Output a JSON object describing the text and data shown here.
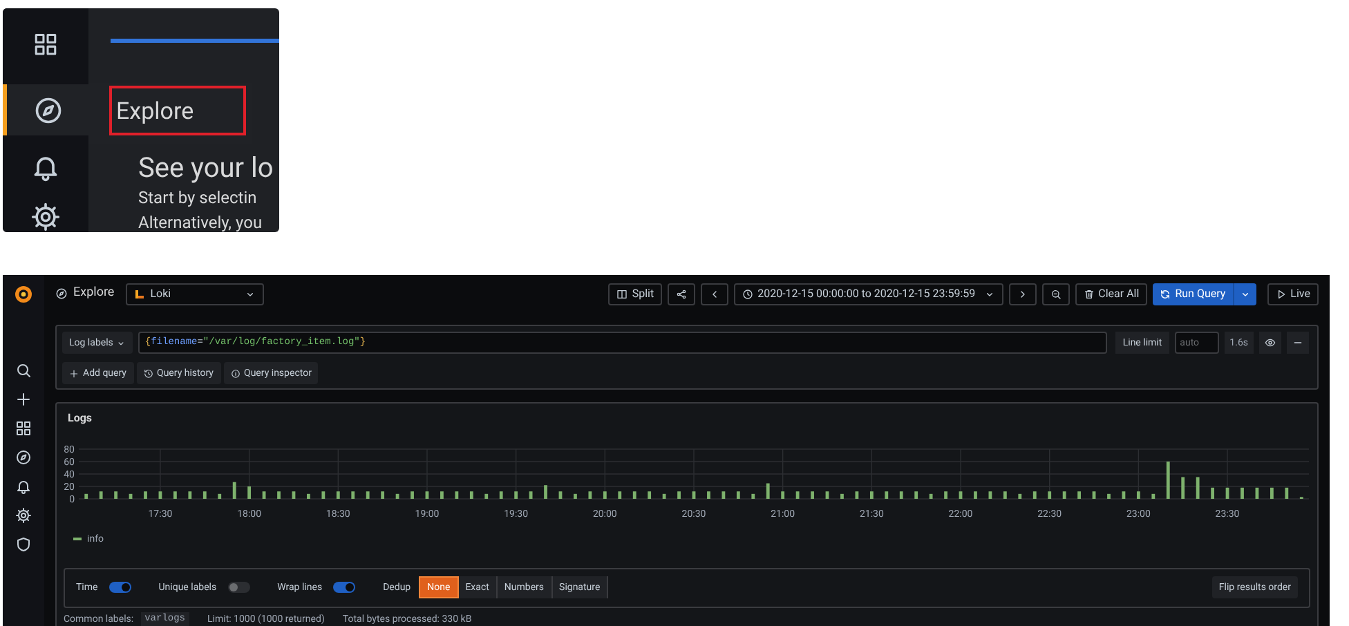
{
  "inset": {
    "tooltip": "Explore",
    "heading": "See your lo",
    "lines": [
      "Start by selectin",
      "Alternatively, you"
    ]
  },
  "toolbar": {
    "title": "Explore",
    "datasource": "Loki",
    "split": "Split",
    "time_range": "2020-12-15 00:00:00 to 2020-12-15 23:59:59",
    "clear": "Clear All",
    "run": "Run Query",
    "live": "Live"
  },
  "query": {
    "label_button": "Log labels",
    "expression": [
      {
        "kind": "brace",
        "text": "{"
      },
      {
        "kind": "label",
        "text": "filename"
      },
      {
        "kind": "operator",
        "text": "="
      },
      {
        "kind": "string",
        "text": "\"/var/log/factory_item.log\""
      },
      {
        "kind": "brace",
        "text": "}"
      }
    ],
    "line_limit_label": "Line limit",
    "line_limit_placeholder": "auto",
    "duration": "1.6s",
    "actions": [
      "Add query",
      "Query history",
      "Query inspector"
    ]
  },
  "logs": {
    "title": "Logs",
    "chart_data": {
      "type": "bar",
      "categories": [
        null,
        null,
        null,
        null,
        null,
        "17:30",
        null,
        null,
        null,
        null,
        null,
        "18:00",
        null,
        null,
        null,
        null,
        null,
        "18:30",
        null,
        null,
        null,
        null,
        null,
        "19:00",
        null,
        null,
        null,
        null,
        null,
        "19:30",
        null,
        null,
        null,
        null,
        null,
        "20:00",
        null,
        null,
        null,
        null,
        null,
        "20:30",
        null,
        null,
        null,
        null,
        null,
        "21:00",
        null,
        null,
        null,
        null,
        null,
        "21:30",
        null,
        null,
        null,
        null,
        null,
        "22:00",
        null,
        null,
        null,
        null,
        null,
        "22:30",
        null,
        null,
        null,
        null,
        null,
        "23:00",
        null,
        null,
        null,
        null,
        null,
        "23:30",
        null,
        null,
        null,
        null,
        null
      ],
      "series": [
        {
          "name": "info",
          "color": "#7eb26d",
          "values": [
            8,
            12,
            12,
            8,
            12,
            12,
            12,
            12,
            12,
            8,
            27,
            20,
            12,
            12,
            12,
            8,
            12,
            12,
            12,
            12,
            12,
            8,
            12,
            12,
            12,
            12,
            12,
            8,
            12,
            12,
            12,
            22,
            12,
            8,
            12,
            12,
            12,
            12,
            12,
            8,
            12,
            12,
            12,
            12,
            12,
            8,
            25,
            12,
            12,
            12,
            12,
            8,
            12,
            12,
            12,
            12,
            12,
            8,
            12,
            12,
            12,
            12,
            12,
            8,
            12,
            12,
            12,
            12,
            12,
            8,
            12,
            12,
            8,
            60,
            35,
            35,
            18,
            18,
            18,
            18,
            18,
            18,
            3
          ]
        }
      ],
      "ylim": [
        0,
        80
      ],
      "yticks": [
        0,
        20,
        40,
        60,
        80
      ],
      "grid": true
    },
    "toggles": [
      {
        "label": "Time",
        "on": true
      },
      {
        "label": "Unique labels",
        "on": false
      },
      {
        "label": "Wrap lines",
        "on": true
      }
    ],
    "dedup_label": "Dedup",
    "dedup": [
      {
        "label": "None",
        "selected": true
      },
      {
        "label": "Exact",
        "selected": false
      },
      {
        "label": "Numbers",
        "selected": false
      },
      {
        "label": "Signature",
        "selected": false
      }
    ],
    "flip": "Flip results order",
    "footer": {
      "common_label": "Common labels:",
      "common_value": "varlogs",
      "limit": "Limit: 1000 (1000 returned)",
      "bytes": "Total bytes processed: 330 kB"
    }
  }
}
